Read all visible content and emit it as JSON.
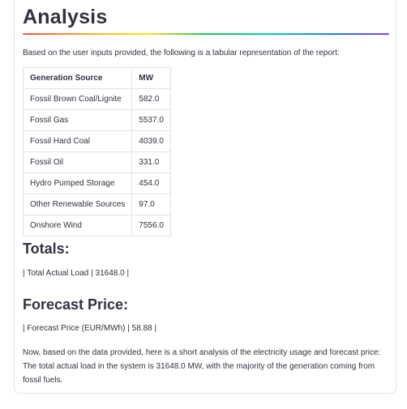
{
  "title": "Analysis",
  "intro": "Based on the user inputs provided, the following is a tabular representation of the report:",
  "table": {
    "headers": [
      "Generation Source",
      "MW"
    ],
    "rows": [
      [
        "Fossil Brown Coal/Lignite",
        "582.0"
      ],
      [
        "Fossil Gas",
        "5537.0"
      ],
      [
        "Fossil Hard Coal",
        "4039.0"
      ],
      [
        "Fossil Oil",
        "331.0"
      ],
      [
        "Hydro Pumped Storage",
        "454.0"
      ],
      [
        "Other Renewable Sources",
        "97.0"
      ],
      [
        "Onshore Wind",
        "7556.0"
      ]
    ]
  },
  "totals": {
    "heading": "Totals:",
    "line": "| Total Actual Load | 31648.0 |"
  },
  "forecast": {
    "heading": "Forecast Price:",
    "line": "| Forecast Price (EUR/MWh) | 58.88 |"
  },
  "analysis_text": "Now, based on the data provided, here is a short analysis of the electricity usage and forecast price: The total actual load in the system is 31648.0 MW, with the majority of the generation coming from fossil fuels."
}
